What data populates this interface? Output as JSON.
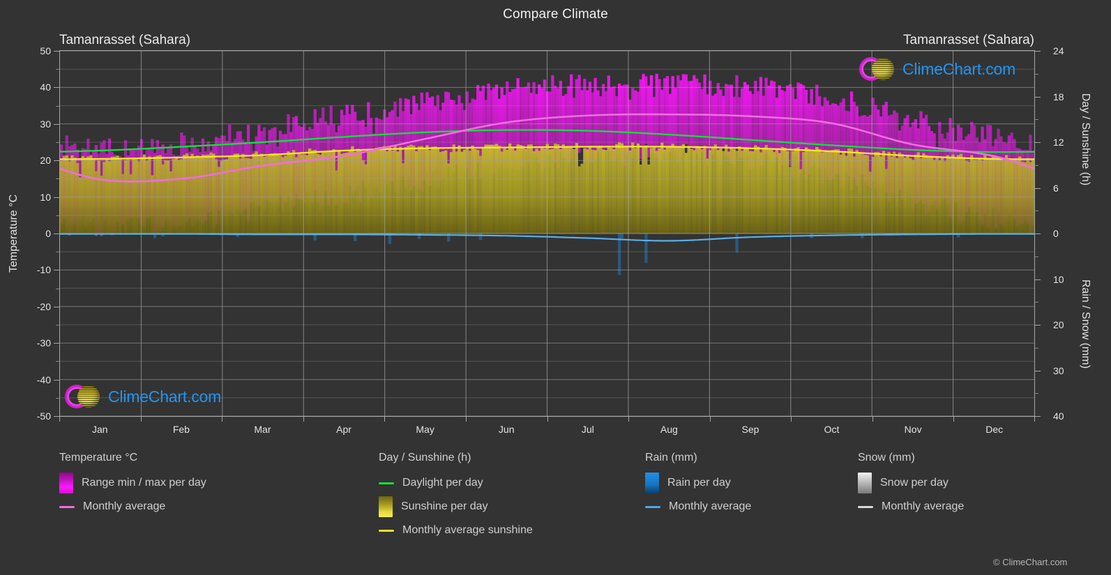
{
  "header": {
    "title": "Compare Climate",
    "station_left": "Tamanrasset (Sahara)",
    "station_right": "Tamanrasset (Sahara)"
  },
  "logo": {
    "text": "ClimeChart.com"
  },
  "copyright": "© ClimeChart.com",
  "axes": {
    "left_title": "Temperature °C",
    "right_top_title": "Day / Sunshine (h)",
    "right_bottom_title": "Rain / Snow (mm)",
    "left_ticks": [
      "50",
      "40",
      "30",
      "20",
      "10",
      "0",
      "-10",
      "-20",
      "-30",
      "-40",
      "-50"
    ],
    "right_top_ticks": [
      "24",
      "18",
      "12",
      "6",
      "0"
    ],
    "right_bottom_ticks": [
      "10",
      "20",
      "30",
      "40"
    ],
    "x_ticks": [
      "Jan",
      "Feb",
      "Mar",
      "Apr",
      "May",
      "Jun",
      "Jul",
      "Aug",
      "Sep",
      "Oct",
      "Nov",
      "Dec"
    ]
  },
  "legend": {
    "columns": [
      {
        "title": "Temperature °C",
        "items": [
          {
            "label": "Range min / max per day",
            "swatch": "gradient-magenta",
            "color": "#e000e0"
          },
          {
            "label": "Monthly average",
            "swatch": "line",
            "color": "#f06de0"
          }
        ]
      },
      {
        "title": "Day / Sunshine (h)",
        "items": [
          {
            "label": "Daylight per day",
            "swatch": "line",
            "color": "#16dd3c"
          },
          {
            "label": "Sunshine per day",
            "swatch": "gradient-yellow",
            "color": "#f2e750"
          },
          {
            "label": "Monthly average sunshine",
            "swatch": "line",
            "color": "#e8e024"
          }
        ]
      },
      {
        "title": "Rain (mm)",
        "items": [
          {
            "label": "Rain per day",
            "swatch": "gradient-blue",
            "color": "#1f8fe8"
          },
          {
            "label": "Monthly average",
            "swatch": "line",
            "color": "#49a8ec"
          }
        ]
      },
      {
        "title": "Snow (mm)",
        "items": [
          {
            "label": "Snow per day",
            "swatch": "gradient-white",
            "color": "#e8e8e8"
          },
          {
            "label": "Monthly average",
            "swatch": "line",
            "color": "#d8d8d8"
          }
        ]
      }
    ]
  },
  "colors": {
    "background": "#333333",
    "grid": "#8d8d8d",
    "text": "#d8d8d8",
    "temp_range": "#e000e0",
    "temp_avg": "#f06de0",
    "daylight": "#16dd3c",
    "sunshine": "#c9bd2e",
    "sunshine_avg": "#f2e724",
    "rain": "#1f8fe8",
    "logo_text": "#2196f3"
  },
  "chart_data": {
    "type": "line",
    "title": "Compare Climate",
    "subtitle": "Tamanrasset (Sahara)",
    "xlabel": "",
    "ylabel": "Temperature °C",
    "ylim": [
      -50,
      50
    ],
    "y2_top_label": "Day / Sunshine (h)",
    "y2_top_lim": [
      0,
      24
    ],
    "y2_bottom_label": "Rain / Snow (mm)",
    "y2_bottom_lim": [
      0,
      40
    ],
    "grid": true,
    "legend_position": "bottom",
    "categories": [
      "Jan",
      "Feb",
      "Mar",
      "Apr",
      "May",
      "Jun",
      "Jul",
      "Aug",
      "Sep",
      "Oct",
      "Nov",
      "Dec"
    ],
    "series": [
      {
        "name": "Monthly average",
        "unit": "°C",
        "color": "#f06de0",
        "values": [
          14.8,
          15.0,
          18.6,
          21.3,
          25.9,
          30.4,
          32.3,
          32.6,
          32.1,
          30.2,
          24.4,
          21.2,
          19.0
        ]
      },
      {
        "name": "Range max per day",
        "unit": "°C",
        "color": "#e000e0",
        "values": [
          23.0,
          24.5,
          28.5,
          32.5,
          36.0,
          39.5,
          40.5,
          40.5,
          40.0,
          37.5,
          31.0,
          26.5
        ]
      },
      {
        "name": "Range min per day",
        "unit": "°C",
        "color": "#e000e0",
        "values": [
          2.0,
          3.0,
          6.5,
          10.5,
          14.5,
          19.0,
          21.0,
          21.5,
          20.5,
          16.0,
          9.0,
          4.0
        ]
      },
      {
        "name": "Daylight per day",
        "unit": "h",
        "color": "#16dd3c",
        "values": [
          10.9,
          11.4,
          12.0,
          12.7,
          13.3,
          13.6,
          13.5,
          13.0,
          12.3,
          11.6,
          11.0,
          10.7
        ]
      },
      {
        "name": "Monthly average sunshine",
        "unit": "h",
        "color": "#f2e724",
        "values": [
          9.8,
          10.0,
          10.3,
          10.9,
          11.2,
          11.3,
          11.4,
          11.4,
          11.2,
          10.8,
          10.2,
          9.8
        ]
      },
      {
        "name": "Monthly average rain",
        "unit": "mm",
        "color": "#49a8ec",
        "values": [
          0.1,
          0.1,
          0.2,
          0.2,
          0.3,
          0.5,
          1.0,
          1.6,
          0.8,
          0.4,
          0.2,
          0.1
        ]
      },
      {
        "name": "Monthly average snow",
        "unit": "mm",
        "color": "#d8d8d8",
        "values": [
          0,
          0,
          0,
          0,
          0,
          0,
          0,
          0,
          0,
          0,
          0,
          0
        ]
      }
    ]
  }
}
